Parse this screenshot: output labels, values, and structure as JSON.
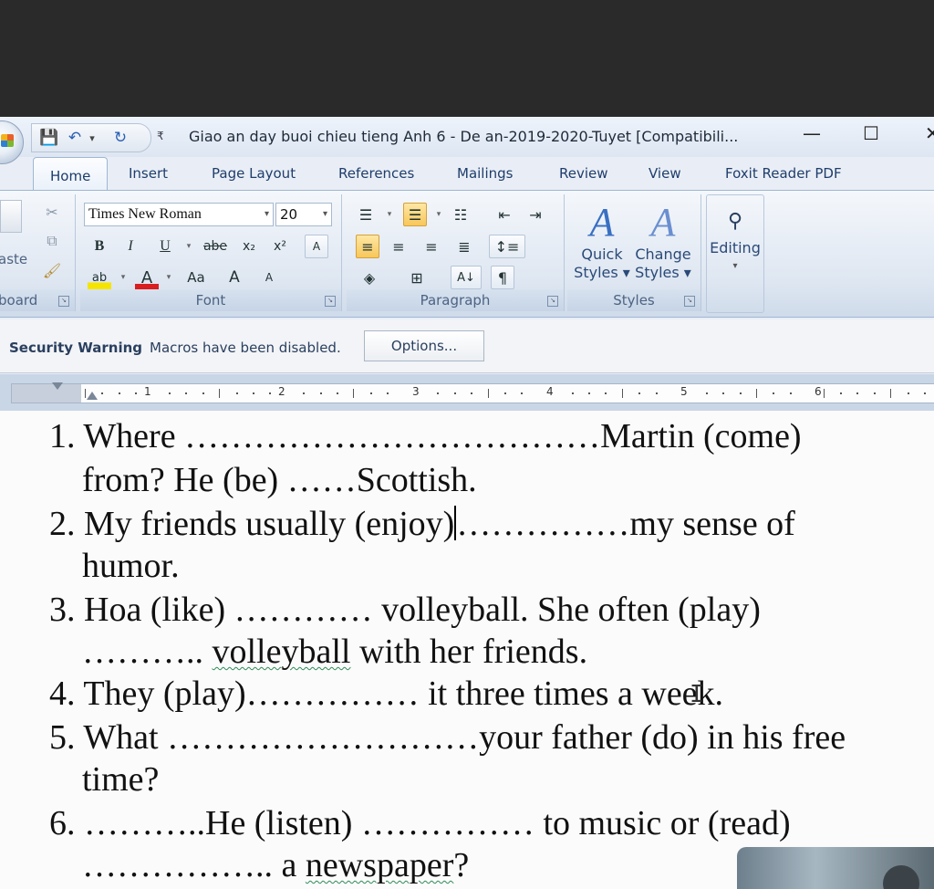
{
  "window": {
    "title": "Giao an day buoi chieu tieng Anh 6 - De an-2019-2020-Tuyet [Compatibili...",
    "minimize": "—",
    "maximize": "☐",
    "close": "✕"
  },
  "qat": {
    "save": "💾",
    "undo": "↶",
    "undo_dd": "▾",
    "redo": "↻",
    "customize": "₹"
  },
  "tabs": [
    "Home",
    "Insert",
    "Page Layout",
    "References",
    "Mailings",
    "Review",
    "View",
    "Foxit Reader PDF"
  ],
  "clipboard": {
    "paste_label": "aste",
    "group_label": "board"
  },
  "font": {
    "name": "Times New Roman",
    "size": "20",
    "group_label": "Font",
    "bold": "B",
    "italic": "I",
    "underline": "U",
    "strike": "abe",
    "subscript": "x₂",
    "superscript": "x²",
    "clear": "A",
    "highlight": "ab",
    "color": "A",
    "case": "Aa",
    "grow": "A",
    "shrink": "A"
  },
  "paragraph": {
    "group_label": "Paragraph",
    "sort": "A↓",
    "pilcrow": "¶"
  },
  "styles": {
    "quick": [
      "Quick",
      "Styles ▾"
    ],
    "change": [
      "Change",
      "Styles ▾"
    ],
    "group_label": "Styles"
  },
  "editing": {
    "label": "Editing",
    "arrow": "▾"
  },
  "security": {
    "title": "Security Warning",
    "message": "Macros have been disabled.",
    "options_label": "Options..."
  },
  "ruler": {
    "numbers": [
      "1",
      "2",
      "3",
      "4",
      "5",
      "6"
    ]
  },
  "document": {
    "lines": [
      "1. Where ………………………………Martin (come)",
      "from? He (be) ……Scottish.",
      "2. My friends usually (enjoy)",
      "……………my sense of",
      "humor.",
      "3. Hoa  (like)  …………  volleyball.  She  often  (play)",
      "……….. ",
      "volleyball",
      " with her friends.",
      "4. They (play)…………… it three times a week.",
      "5. What  ………………………your father (do) in his free",
      "time?",
      "6. ………..He  (listen)  ……………  to  music  or  (read)",
      "…………….. a ",
      "newspaper",
      "?"
    ]
  },
  "colors": {
    "ribbon_accent": "#3a6fc2",
    "selected": "#f7c75a",
    "text": "#111111"
  }
}
